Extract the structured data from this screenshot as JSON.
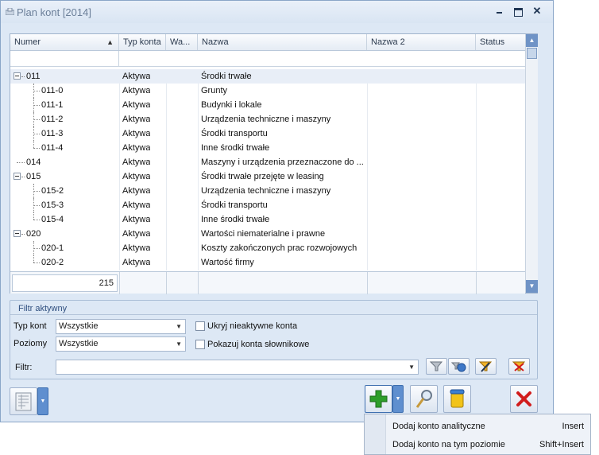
{
  "window": {
    "title": "Plan kont [2014]",
    "minimize_label": "",
    "maximize_label": "",
    "close_label": "✕"
  },
  "grid": {
    "columns": [
      "Numer",
      "Typ konta",
      "Wa...",
      "Nazwa",
      "Nazwa 2",
      "Status"
    ],
    "sort_indicator": "▲",
    "rows": [
      {
        "numer": "011",
        "typ": "Aktywa",
        "nazwa": "Środki trwałe",
        "level": 0,
        "expanded": true
      },
      {
        "numer": "011-0",
        "typ": "Aktywa",
        "nazwa": "Grunty",
        "level": 1
      },
      {
        "numer": "011-1",
        "typ": "Aktywa",
        "nazwa": "Budynki i lokale",
        "level": 1
      },
      {
        "numer": "011-2",
        "typ": "Aktywa",
        "nazwa": "Urządzenia techniczne i maszyny",
        "level": 1
      },
      {
        "numer": "011-3",
        "typ": "Aktywa",
        "nazwa": "Środki transportu",
        "level": 1
      },
      {
        "numer": "011-4",
        "typ": "Aktywa",
        "nazwa": "Inne środki trwałe",
        "level": 1
      },
      {
        "numer": "014",
        "typ": "Aktywa",
        "nazwa": "Maszyny i urządzenia przeznaczone do ...",
        "level": 0
      },
      {
        "numer": "015",
        "typ": "Aktywa",
        "nazwa": "Środki trwałe przejęte w leasing",
        "level": 0,
        "expanded": true
      },
      {
        "numer": "015-2",
        "typ": "Aktywa",
        "nazwa": "Urządzenia techniczne i maszyny",
        "level": 1
      },
      {
        "numer": "015-3",
        "typ": "Aktywa",
        "nazwa": "Środki transportu",
        "level": 1
      },
      {
        "numer": "015-4",
        "typ": "Aktywa",
        "nazwa": "Inne środki trwałe",
        "level": 1
      },
      {
        "numer": "020",
        "typ": "Aktywa",
        "nazwa": "Wartości niematerialne i prawne",
        "level": 0,
        "expanded": true
      },
      {
        "numer": "020-1",
        "typ": "Aktywa",
        "nazwa": "Koszty zakończonych prac rozwojowych",
        "level": 1
      },
      {
        "numer": "020-2",
        "typ": "Aktywa",
        "nazwa": "Wartość firmy",
        "level": 1
      }
    ],
    "record_count": "215"
  },
  "filter": {
    "section_title": "Filtr aktywny",
    "typ_kont_label": "Typ kont",
    "typ_kont_value": "Wszystkie",
    "poziomy_label": "Poziomy",
    "poziomy_value": "Wszystkie",
    "ukryj_label": "Ukryj nieaktywne konta",
    "pokazuj_label": "Pokazuj konta słownikowe",
    "filtr_label": "Filtr:",
    "filtr_value": ""
  },
  "menu": {
    "items": [
      {
        "label": "Dodaj konto analityczne",
        "shortcut": "Insert"
      },
      {
        "label": "Dodaj konto na tym poziomie",
        "shortcut": "Shift+Insert"
      }
    ]
  },
  "colors": {
    "window_bg": "#dde8f5",
    "add_green": "#2e9e2a",
    "delete_red": "#d11c1c",
    "accent_blue": "#5f8fcf"
  },
  "icons": {
    "filter": "funnel-icon",
    "add": "plus-icon",
    "edit": "magnifier-icon",
    "delete": "x-icon",
    "trash": "trash-icon",
    "print": "print-icon"
  }
}
